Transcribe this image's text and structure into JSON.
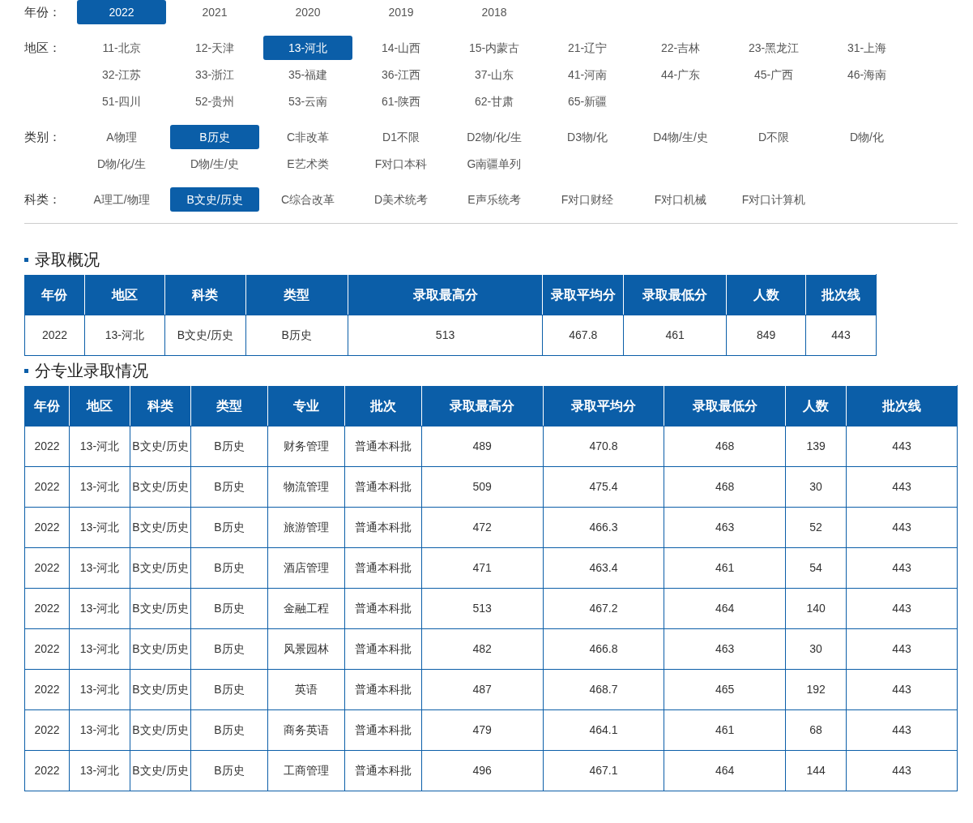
{
  "filters": [
    {
      "label": "年份：",
      "options": [
        {
          "text": "2022",
          "selected": true
        },
        {
          "text": "2021",
          "selected": false
        },
        {
          "text": "2020",
          "selected": false
        },
        {
          "text": "2019",
          "selected": false
        },
        {
          "text": "2018",
          "selected": false
        }
      ]
    },
    {
      "label": "地区：",
      "options": [
        {
          "text": "11-北京",
          "selected": false
        },
        {
          "text": "12-天津",
          "selected": false
        },
        {
          "text": "13-河北",
          "selected": true
        },
        {
          "text": "14-山西",
          "selected": false
        },
        {
          "text": "15-内蒙古",
          "selected": false
        },
        {
          "text": "21-辽宁",
          "selected": false
        },
        {
          "text": "22-吉林",
          "selected": false
        },
        {
          "text": "23-黑龙江",
          "selected": false
        },
        {
          "text": "31-上海",
          "selected": false
        },
        {
          "text": "32-江苏",
          "selected": false
        },
        {
          "text": "33-浙江",
          "selected": false
        },
        {
          "text": "35-福建",
          "selected": false
        },
        {
          "text": "36-江西",
          "selected": false
        },
        {
          "text": "37-山东",
          "selected": false
        },
        {
          "text": "41-河南",
          "selected": false
        },
        {
          "text": "44-广东",
          "selected": false
        },
        {
          "text": "45-广西",
          "selected": false
        },
        {
          "text": "46-海南",
          "selected": false
        },
        {
          "text": "51-四川",
          "selected": false
        },
        {
          "text": "52-贵州",
          "selected": false
        },
        {
          "text": "53-云南",
          "selected": false
        },
        {
          "text": "61-陕西",
          "selected": false
        },
        {
          "text": "62-甘肃",
          "selected": false
        },
        {
          "text": "65-新疆",
          "selected": false
        }
      ]
    },
    {
      "label": "类别：",
      "options": [
        {
          "text": "A物理",
          "selected": false
        },
        {
          "text": "B历史",
          "selected": true
        },
        {
          "text": "C非改革",
          "selected": false
        },
        {
          "text": "D1不限",
          "selected": false
        },
        {
          "text": "D2物/化/生",
          "selected": false
        },
        {
          "text": "D3物/化",
          "selected": false
        },
        {
          "text": "D4物/生/史",
          "selected": false
        },
        {
          "text": "D不限",
          "selected": false
        },
        {
          "text": "D物/化",
          "selected": false
        },
        {
          "text": "D物/化/生",
          "selected": false
        },
        {
          "text": "D物/生/史",
          "selected": false
        },
        {
          "text": "E艺术类",
          "selected": false
        },
        {
          "text": "F对口本科",
          "selected": false
        },
        {
          "text": "G南疆单列",
          "selected": false
        }
      ]
    },
    {
      "label": "科类：",
      "options": [
        {
          "text": "A理工/物理",
          "selected": false
        },
        {
          "text": "B文史/历史",
          "selected": true
        },
        {
          "text": "C综合改革",
          "selected": false
        },
        {
          "text": "D美术统考",
          "selected": false
        },
        {
          "text": "E声乐统考",
          "selected": false
        },
        {
          "text": "F对口财经",
          "selected": false
        },
        {
          "text": "F对口机械",
          "selected": false
        },
        {
          "text": "F对口计算机",
          "selected": false
        }
      ]
    }
  ],
  "summary": {
    "title": "录取概况",
    "columns": [
      "年份",
      "地区",
      "科类",
      "类型",
      "录取最高分",
      "录取平均分",
      "录取最低分",
      "人数",
      "批次线"
    ],
    "rows": [
      [
        "2022",
        "13-河北",
        "B文史/历史",
        "B历史",
        "513",
        "467.8",
        "461",
        "849",
        "443"
      ]
    ]
  },
  "majors": {
    "title": "分专业录取情况",
    "columns": [
      "年份",
      "地区",
      "科类",
      "类型",
      "专业",
      "批次",
      "录取最高分",
      "录取平均分",
      "录取最低分",
      "人数",
      "批次线"
    ],
    "rows": [
      [
        "2022",
        "13-河北",
        "B文史/历史",
        "B历史",
        "财务管理",
        "普通本科批",
        "489",
        "470.8",
        "468",
        "139",
        "443"
      ],
      [
        "2022",
        "13-河北",
        "B文史/历史",
        "B历史",
        "物流管理",
        "普通本科批",
        "509",
        "475.4",
        "468",
        "30",
        "443"
      ],
      [
        "2022",
        "13-河北",
        "B文史/历史",
        "B历史",
        "旅游管理",
        "普通本科批",
        "472",
        "466.3",
        "463",
        "52",
        "443"
      ],
      [
        "2022",
        "13-河北",
        "B文史/历史",
        "B历史",
        "酒店管理",
        "普通本科批",
        "471",
        "463.4",
        "461",
        "54",
        "443"
      ],
      [
        "2022",
        "13-河北",
        "B文史/历史",
        "B历史",
        "金融工程",
        "普通本科批",
        "513",
        "467.2",
        "464",
        "140",
        "443"
      ],
      [
        "2022",
        "13-河北",
        "B文史/历史",
        "B历史",
        "风景园林",
        "普通本科批",
        "482",
        "466.8",
        "463",
        "30",
        "443"
      ],
      [
        "2022",
        "13-河北",
        "B文史/历史",
        "B历史",
        "英语",
        "普通本科批",
        "487",
        "468.7",
        "465",
        "192",
        "443"
      ],
      [
        "2022",
        "13-河北",
        "B文史/历史",
        "B历史",
        "商务英语",
        "普通本科批",
        "479",
        "464.1",
        "461",
        "68",
        "443"
      ],
      [
        "2022",
        "13-河北",
        "B文史/历史",
        "B历史",
        "工商管理",
        "普通本科批",
        "496",
        "467.1",
        "464",
        "144",
        "443"
      ]
    ]
  }
}
